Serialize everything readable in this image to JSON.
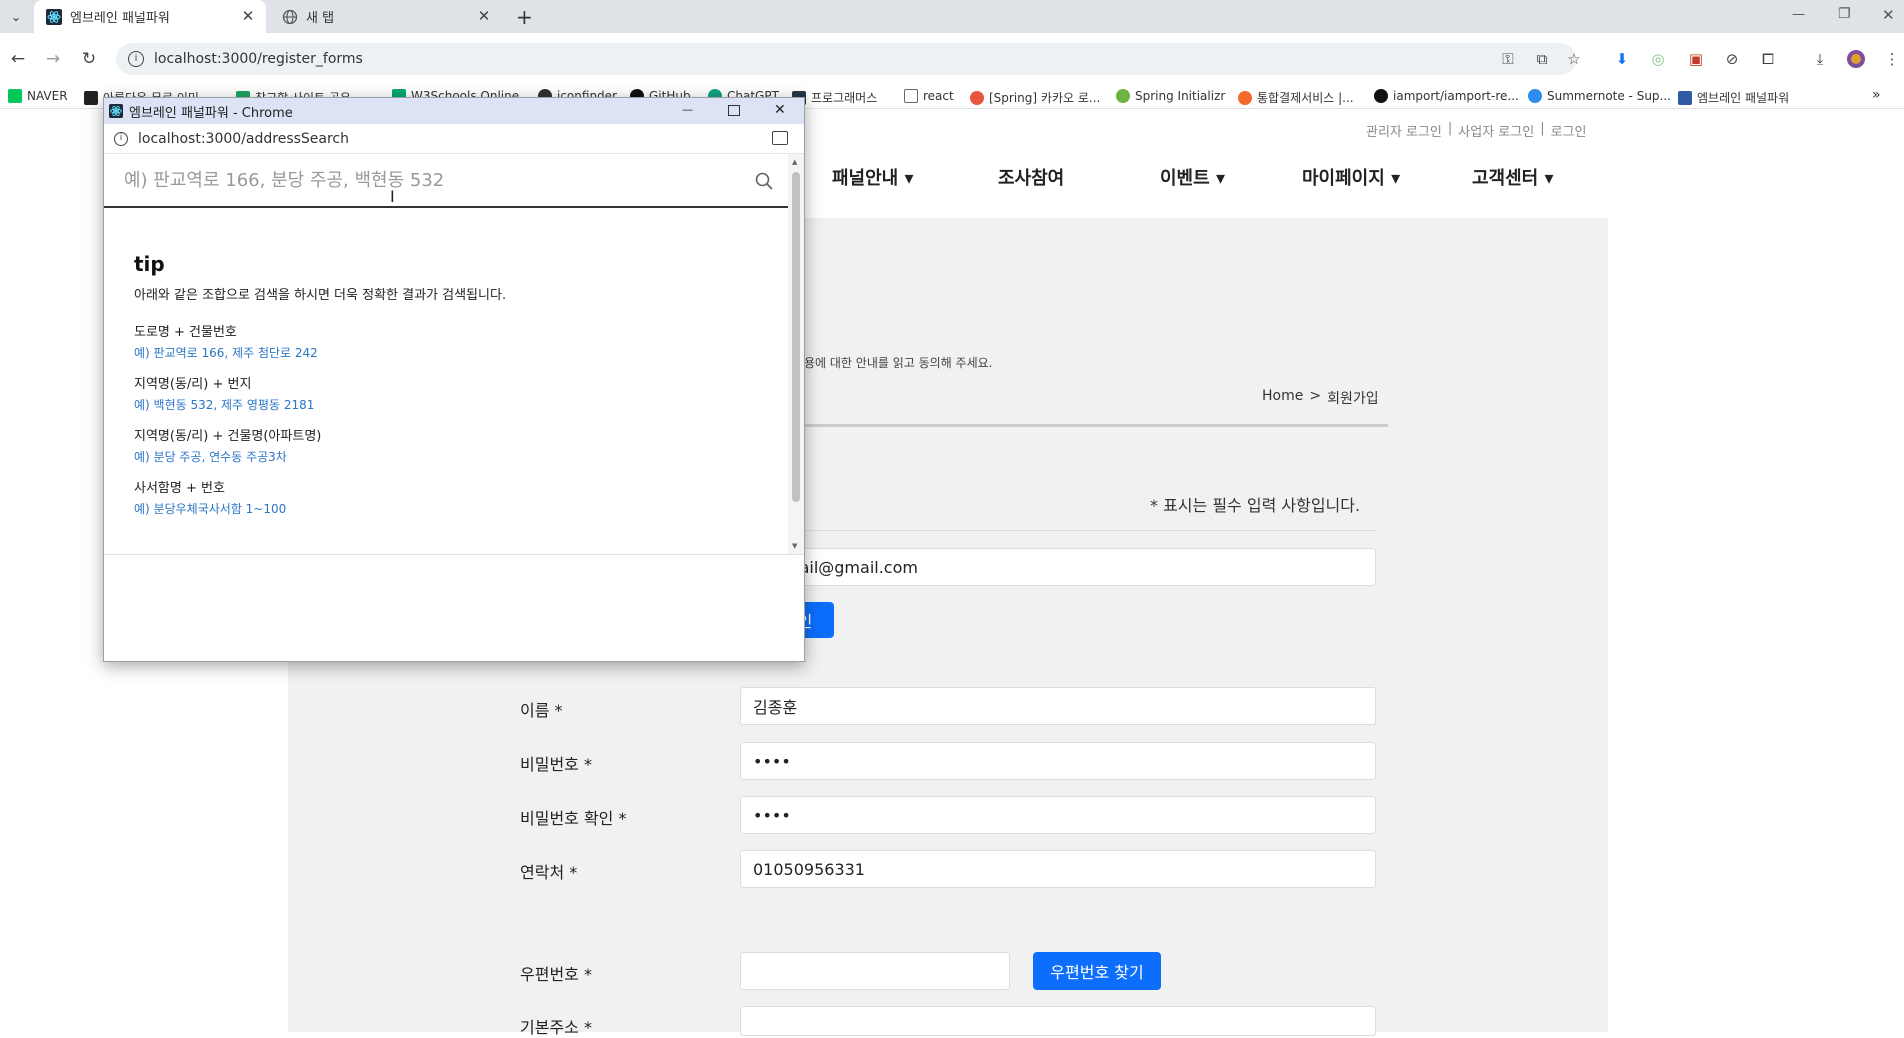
{
  "browser": {
    "tabs": [
      {
        "title": "엠브레인 패널파워",
        "active": true
      },
      {
        "title": "새 탭",
        "active": false
      }
    ],
    "new_tab": "+",
    "url": "localhost:3000/register_forms",
    "window_controls": {
      "minimize": "—",
      "restore": "❐",
      "close": "✕"
    },
    "bookmarks": [
      {
        "label": "NAVER",
        "color": "#03c75a"
      },
      {
        "label": "아름다운 무료 이미...",
        "color": "#222222"
      },
      {
        "label": "참고할 사이트 공유...",
        "color": "#1fa463"
      },
      {
        "label": "W3Schools Online...",
        "color": "#04aa6d"
      },
      {
        "label": "iconfinder",
        "color": "#333333"
      },
      {
        "label": "GitHub",
        "color": "#111111"
      },
      {
        "label": "ChatGPT",
        "color": "#10a37f"
      },
      {
        "label": "프로그래머스",
        "color": "#263747"
      },
      {
        "label": "react",
        "color": "#777777"
      },
      {
        "label": "[Spring] 카카오 로...",
        "color": "#e8563f"
      },
      {
        "label": "Spring Initializr",
        "color": "#6db33f"
      },
      {
        "label": "통합결제서비스 |...",
        "color": "#f26b2d"
      },
      {
        "label": "iamport/iamport-re...",
        "color": "#111111"
      },
      {
        "label": "Summernote - Sup...",
        "color": "#2d8cf0"
      },
      {
        "label": "엠브레인 패널파워",
        "color": "#2e5aa8"
      }
    ],
    "bookmarks_more": "»"
  },
  "page": {
    "top_links": [
      "관리자 로그인",
      "|",
      "사업자 로그인",
      "|",
      "로그인"
    ],
    "menu": [
      "패널안내 ▾",
      "조사참여",
      "이벤트 ▾",
      "마이페이지 ▾",
      "고객센터 ▾"
    ],
    "agree_text": "용에 대한 안내를 읽고 동의해 주세요.",
    "breadcrumb": {
      "home": "Home",
      "sep": ">",
      "current": "회원가입"
    },
    "required_note": "* 표시는 필수 입력 사항입니다.",
    "email_value": "rail@gmail.com",
    "email_check_button": "인",
    "fields": [
      {
        "label": "이름 *",
        "value": "김종훈"
      },
      {
        "label": "비밀번호 *",
        "value": "••••"
      },
      {
        "label": "비밀번호 확인 *",
        "value": "••••"
      },
      {
        "label": "연락처 *",
        "value": "01050956331"
      }
    ],
    "postcode": {
      "label": "우편번호 *",
      "value": "",
      "button": "우편번호 찾기"
    },
    "address_label": "기본주소 *"
  },
  "popup": {
    "title": "엠브레인 패널파워 - Chrome",
    "url": "localhost:3000/addressSearch",
    "search_placeholder": "예) 판교역로 166, 분당 주공, 백현동 532",
    "tip_title": "tip",
    "tip_desc": "아래와 같은 조합으로 검색을 하시면 더욱 정확한 결과가 검색됩니다.",
    "tips": [
      {
        "heading": "도로명 + 건물번호",
        "example": "예) 판교역로 166,  제주 첨단로 242"
      },
      {
        "heading": "지역명(동/리) + 번지",
        "example": "예) 백현동 532,  제주 영평동 2181"
      },
      {
        "heading": "지역명(동/리) + 건물명(아파트명)",
        "example": "예) 분당 주공,  연수동 주공3차"
      },
      {
        "heading": "사서함명 + 번호",
        "example": "예) 분당우체국사서함 1~100"
      }
    ]
  }
}
